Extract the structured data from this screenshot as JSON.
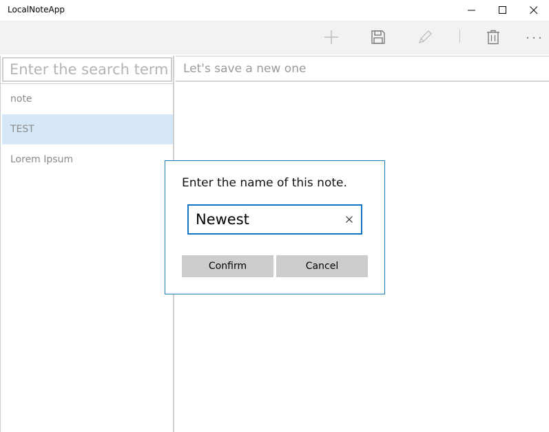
{
  "app": {
    "title": "LocalNoteApp"
  },
  "window_controls": {
    "minimize_icon": "minimize-icon",
    "maximize_icon": "maximize-icon",
    "close_icon": "close-icon"
  },
  "commandbar": {
    "buttons": [
      {
        "name": "add",
        "icon": "plus-icon"
      },
      {
        "name": "save",
        "icon": "floppy-disk-icon"
      },
      {
        "name": "edit",
        "icon": "pencil-icon"
      },
      {
        "name": "delete",
        "icon": "trash-icon"
      },
      {
        "name": "more",
        "icon": "more-ellipsis-icon"
      }
    ]
  },
  "search": {
    "placeholder": "Enter the search term here",
    "value": ""
  },
  "notes": [
    {
      "title": "note",
      "selected": false
    },
    {
      "title": "TEST",
      "selected": true
    },
    {
      "title": "Lorem Ipsum",
      "selected": false
    }
  ],
  "editor": {
    "title_placeholder": "Let's save a new one",
    "title_value": ""
  },
  "dialog": {
    "title": "Enter the name of this note.",
    "input_value": "Newest",
    "confirm_label": "Confirm",
    "cancel_label": "Cancel"
  },
  "colors": {
    "accent": "#0e72c5",
    "dialog_border": "#1a7ab8",
    "selection": "#d6e8f7",
    "button_bg": "#cccccc",
    "commandbar_bg": "#f2f2f2"
  }
}
